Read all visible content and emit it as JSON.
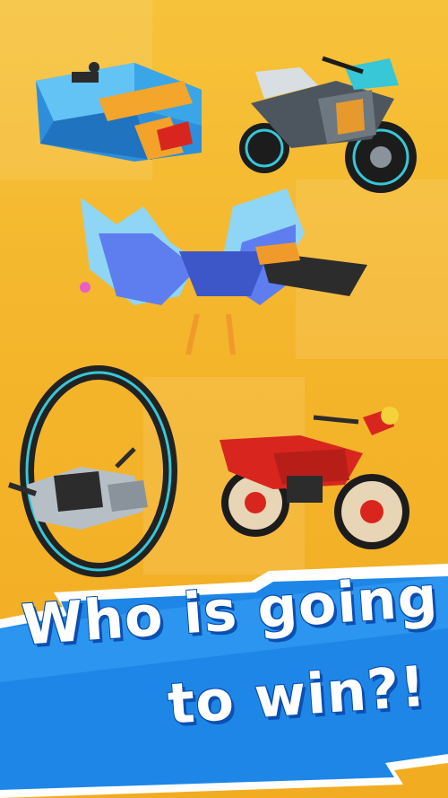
{
  "banner": {
    "line1": "Who is going",
    "line2": "to win?!"
  },
  "vehicles": [
    {
      "name": "jet-hover-bike",
      "color": "#3aa6e8"
    },
    {
      "name": "cyber-motorcycle",
      "color": "#5c6670"
    },
    {
      "name": "winged-glider",
      "color": "#6f8df0"
    },
    {
      "name": "monowheel",
      "color": "#9aa3ab"
    },
    {
      "name": "retro-motorcycle",
      "color": "#d8261f"
    }
  ],
  "colors": {
    "background": "#f4b62c",
    "banner_blue": "#1e86e6",
    "title_text": "#ffffff"
  }
}
